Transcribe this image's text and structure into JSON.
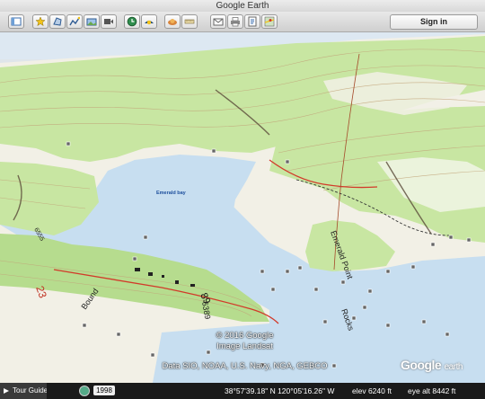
{
  "window": {
    "title": "Google Earth"
  },
  "toolbar": {
    "buttons": [
      {
        "name": "sidebar-toggle-button",
        "icon": "sidebar-icon"
      },
      {
        "name": "add-placemark-button",
        "icon": "placemark-pin-icon"
      },
      {
        "name": "add-polygon-button",
        "icon": "polygon-icon"
      },
      {
        "name": "add-path-button",
        "icon": "path-icon"
      },
      {
        "name": "add-image-overlay-button",
        "icon": "image-overlay-icon"
      },
      {
        "name": "record-tour-button",
        "icon": "record-tour-icon"
      },
      {
        "name": "historical-imagery-button",
        "icon": "clock-icon"
      },
      {
        "name": "sunlight-button",
        "icon": "sun-icon"
      },
      {
        "name": "switch-planet-button",
        "icon": "planet-icon"
      },
      {
        "name": "ruler-button",
        "icon": "ruler-icon"
      },
      {
        "name": "email-button",
        "icon": "email-icon"
      },
      {
        "name": "print-button",
        "icon": "print-icon"
      },
      {
        "name": "save-image-button",
        "icon": "save-image-icon"
      },
      {
        "name": "maps-button",
        "icon": "google-maps-icon"
      }
    ],
    "sign_in_label": "Sign in"
  },
  "map": {
    "place_labels": {
      "emerald_bay": "Emerald bay",
      "emerald_point": "Emerald Point",
      "rocks": "Rocks",
      "route_89": "89",
      "shore_left": "Bound",
      "number_23": "23",
      "number_6389": "6389",
      "number_6555": "6555"
    },
    "attribution": [
      "© 2016 Google",
      "Image Landsat",
      "Data SIO, NOAA, U.S. Navy, NGA, GEBCO"
    ],
    "logo_main": "Google",
    "logo_sub": "earth"
  },
  "status": {
    "tour_guide": "Tour Guide",
    "year": "1998",
    "coordinates": "38°57'39.18\" N  120°05'16.26\" W",
    "elevation": "elev  6240 ft",
    "eye_alt": "eye alt  8442 ft"
  },
  "colors": {
    "water": "#c7def0",
    "forest": "#c8e6a2",
    "land": "#f3f1ea",
    "contour": "#c2a57a",
    "road_red": "#d23a2a"
  }
}
